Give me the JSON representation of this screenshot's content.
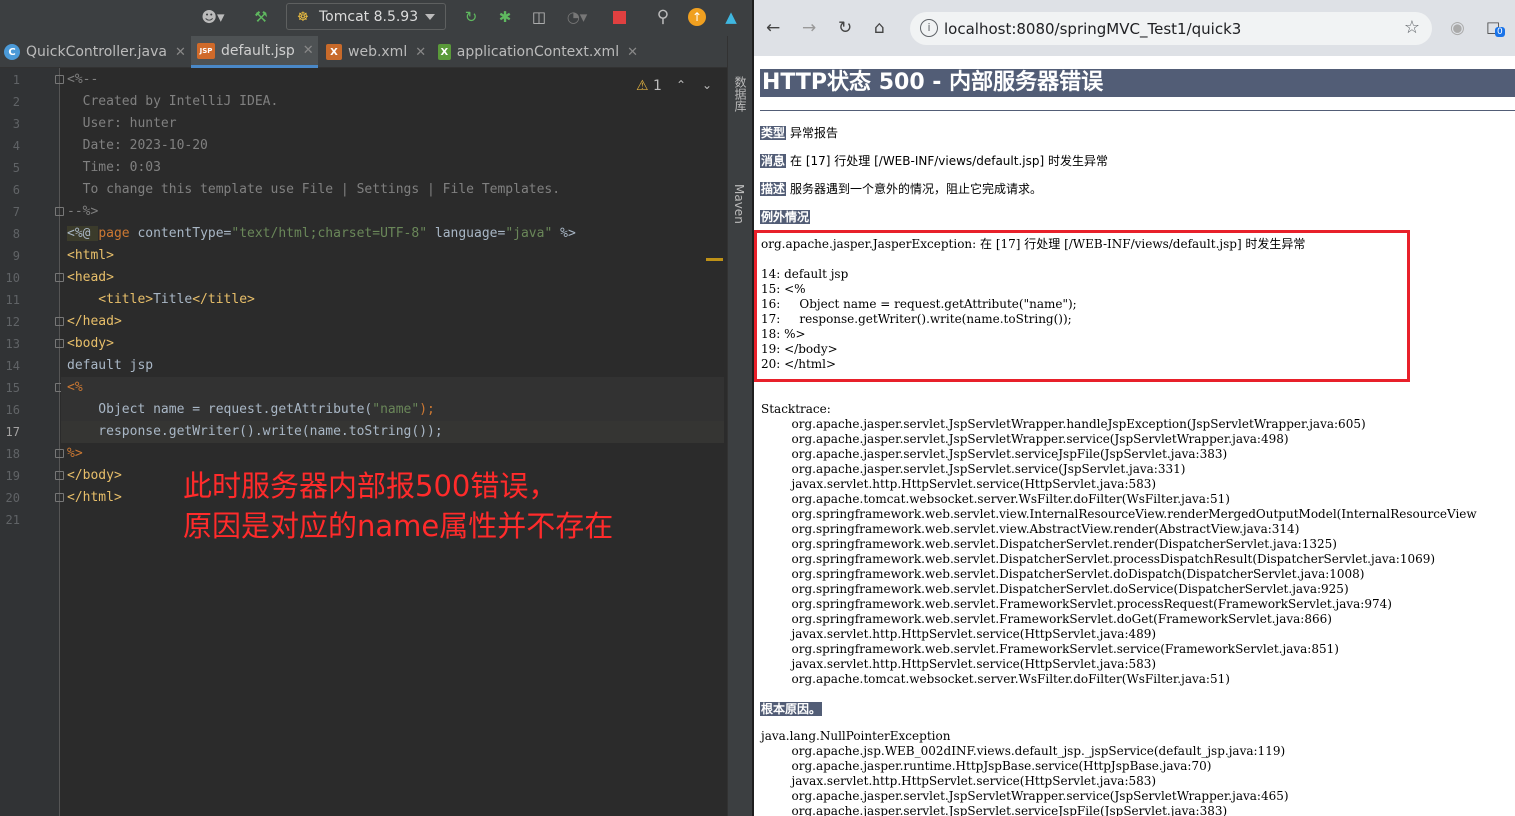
{
  "ide": {
    "run_config": "Tomcat 8.5.93",
    "tabs": [
      {
        "label": "QuickController.java",
        "icon": "C"
      },
      {
        "label": "default.jsp",
        "icon": "JSP"
      },
      {
        "label": "web.xml",
        "icon": "X"
      },
      {
        "label": "applicationContext.xml",
        "icon": "X"
      }
    ],
    "warning_count": "1",
    "side_labels": [
      "数据库",
      "Maven"
    ],
    "line_numbers": [
      "1",
      "2",
      "3",
      "4",
      "5",
      "6",
      "7",
      "8",
      "9",
      "10",
      "11",
      "12",
      "13",
      "14",
      "15",
      "16",
      "17",
      "18",
      "19",
      "20",
      "21"
    ],
    "code": {
      "l1": "<%--",
      "l2": "  Created by IntelliJ IDEA.",
      "l3": "  User: hunter",
      "l4": "  Date: 2023-10-20",
      "l5": "  Time: 0:03",
      "l6": "  To change this template use File | Settings | File Templates.",
      "l7": "--%>",
      "l8a": "<%@ ",
      "l8b": "page",
      "l8c": " contentType=",
      "l8d": "\"text/html;charset=UTF-8\"",
      "l8e": " language=",
      "l8f": "\"java\"",
      "l8g": " %>",
      "l9": "<html>",
      "l10": "<head>",
      "l11a": "    <title>",
      "l11b": "Title",
      "l11c": "</title>",
      "l12": "</head>",
      "l13": "<body>",
      "l14": "default jsp",
      "l15": "<%",
      "l16a": "    Object name = request.getAttribute(",
      "l16b": "\"name\"",
      "l16c": ");",
      "l17a": "    response.getWriter().write(name.toString());",
      "l18": "%>",
      "l19": "</body>",
      "l20": "</html>"
    },
    "annotation_line1": "此时服务器内部报500错误，",
    "annotation_line2": "原因是对应的name属性并不存在"
  },
  "browser": {
    "url": "localhost:8080/springMVC_Test1/quick3",
    "heading": "HTTP状态 500 - 内部服务器错误",
    "type_label": "类型",
    "type_value": "异常报告",
    "message_label": "消息",
    "message_value": "在 [17] 行处理 [/WEB-INF/views/default.jsp] 时发生异常",
    "desc_label": "描述",
    "desc_value": "服务器遇到一个意外的情况，阻止它完成请求。",
    "exception_label": "例外情况",
    "exception_text": "org.apache.jasper.JasperException: 在 [17] 行处理 [/WEB-INF/views/default.jsp] 时发生异常\n\n14: default jsp\n15: <%\n16:     Object name = request.getAttribute(\"name\");\n17:     response.getWriter().write(name.toString());\n18: %>\n19: </body>\n20: </html>",
    "stacktrace_text": "Stacktrace:\n        org.apache.jasper.servlet.JspServletWrapper.handleJspException(JspServletWrapper.java:605)\n        org.apache.jasper.servlet.JspServletWrapper.service(JspServletWrapper.java:498)\n        org.apache.jasper.servlet.JspServlet.serviceJspFile(JspServlet.java:383)\n        org.apache.jasper.servlet.JspServlet.service(JspServlet.java:331)\n        javax.servlet.http.HttpServlet.service(HttpServlet.java:583)\n        org.apache.tomcat.websocket.server.WsFilter.doFilter(WsFilter.java:51)\n        org.springframework.web.servlet.view.InternalResourceView.renderMergedOutputModel(InternalResourceView\n        org.springframework.web.servlet.view.AbstractView.render(AbstractView.java:314)\n        org.springframework.web.servlet.DispatcherServlet.render(DispatcherServlet.java:1325)\n        org.springframework.web.servlet.DispatcherServlet.processDispatchResult(DispatcherServlet.java:1069)\n        org.springframework.web.servlet.DispatcherServlet.doDispatch(DispatcherServlet.java:1008)\n        org.springframework.web.servlet.DispatcherServlet.doService(DispatcherServlet.java:925)\n        org.springframework.web.servlet.FrameworkServlet.processRequest(FrameworkServlet.java:974)\n        org.springframework.web.servlet.FrameworkServlet.doGet(FrameworkServlet.java:866)\n        javax.servlet.http.HttpServlet.service(HttpServlet.java:489)\n        org.springframework.web.servlet.FrameworkServlet.service(FrameworkServlet.java:851)\n        javax.servlet.http.HttpServlet.service(HttpServlet.java:583)\n        org.apache.tomcat.websocket.server.WsFilter.doFilter(WsFilter.java:51)",
    "root_cause_label": "根本原因。",
    "root_cause_text": "java.lang.NullPointerException\n        org.apache.jsp.WEB_002dINF.views.default_jsp._jspService(default_jsp.java:119)\n        org.apache.jasper.runtime.HttpJspBase.service(HttpJspBase.java:70)\n        javax.servlet.http.HttpServlet.service(HttpServlet.java:583)\n        org.apache.jasper.servlet.JspServletWrapper.service(JspServletWrapper.java:465)\n        org.apache.jasper.servlet.JspServlet.serviceJspFile(JspServlet.java:383)",
    "extension_badge": "0"
  }
}
